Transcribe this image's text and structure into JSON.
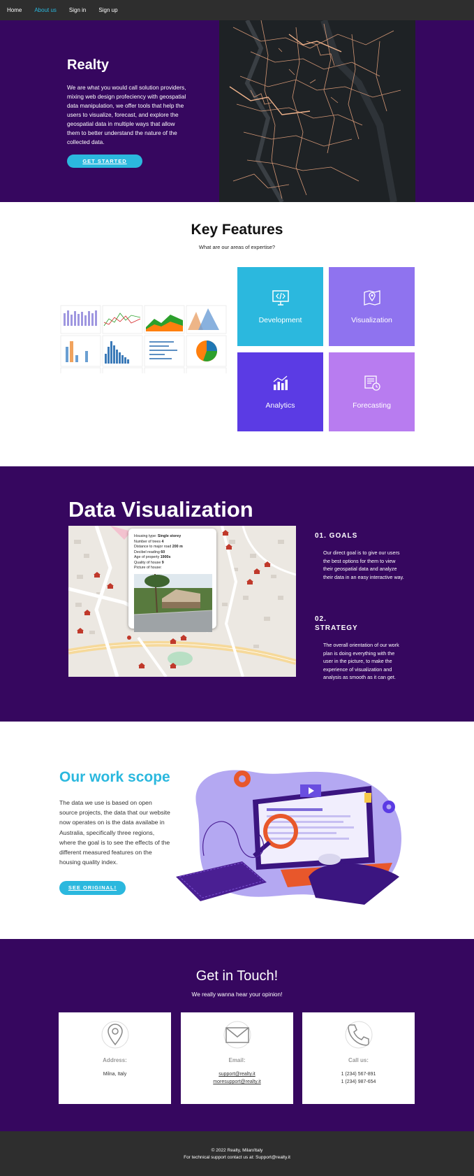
{
  "nav": {
    "items": [
      {
        "label": "Home",
        "active": false
      },
      {
        "label": "About us",
        "active": true
      },
      {
        "label": "Sign in",
        "active": false
      },
      {
        "label": "Sign up",
        "active": false
      }
    ]
  },
  "hero": {
    "title": "Realty",
    "description": "We are what you would call solution providers, mixing web design profeciency with geospatial data manipulation, we offer tools that help the users to visualize, forecast, and explore the geospatial data in multiple ways that allow them to better understand the nature of the collected data.",
    "button_label": "GET STARTED"
  },
  "features": {
    "title": "Key Features",
    "subtitle": "What are our areas of expertise?",
    "tiles": [
      {
        "label": "Development",
        "icon": "code-monitor-icon",
        "color": "#2bb8de"
      },
      {
        "label": "Visualization",
        "icon": "map-pin-icon",
        "color": "#8f73ef"
      },
      {
        "label": "Analytics",
        "icon": "bar-chart-icon",
        "color": "#5b3be4"
      },
      {
        "label": "Forecasting",
        "icon": "document-clock-icon",
        "color": "#b87cf0"
      }
    ]
  },
  "data_viz": {
    "title": "Data Visualization",
    "popup": {
      "housing_type_label": "Housing type: ",
      "housing_type_value": "Single storey",
      "trees_label": "Number of trees ",
      "trees_value": "4",
      "distance_label": "Distance to major road ",
      "distance_value": "200 m",
      "decibel_label": "Decibel reading ",
      "decibel_value": "60",
      "age_label": "Age of property ",
      "age_value": "1900s",
      "quality_label": "Quality of house ",
      "quality_value": "9",
      "picture_label": "Picture of house:"
    },
    "goals": {
      "heading": "01. GOALS",
      "text": "Our direct goal is to give our users the best options for them to view their geospatial data and analyze their data in an easy interactive way."
    },
    "strategy": {
      "heading_line1": "02.",
      "heading_line2": "STRATEGY",
      "text": "The overall orientation of our work plan is doing everything with the user in the picture, to make the experience of visualization and analysis as smooth as it can get."
    }
  },
  "scope": {
    "title": "Our work scope",
    "text": "The data we use is  based on open source projects, the data that our website now operates on is the data availabe in Australia, specifically three regions, where the goal is to see the effects of the different measured features on the housing quality index.",
    "button_label": "SEE ORIGINAL!"
  },
  "contact": {
    "title": "Get in Touch!",
    "subtitle": "We really wanna hear your opinion!",
    "cards": [
      {
        "title": "Address:",
        "lines": [
          "Milna, Italy"
        ],
        "icon": "location-pin-icon"
      },
      {
        "title": "Email:",
        "lines": [
          "support@realty.it",
          "moresupport@realty.it"
        ],
        "icon": "envelope-icon"
      },
      {
        "title": "Call us:",
        "lines": [
          "1 (234) 567-891",
          "1 (234) 987-654"
        ],
        "icon": "phone-icon"
      }
    ]
  },
  "footer": {
    "copyright": "© 2022 Realty, Milan/Italy",
    "support": "For technical support contact us at: Support@realty.it"
  }
}
